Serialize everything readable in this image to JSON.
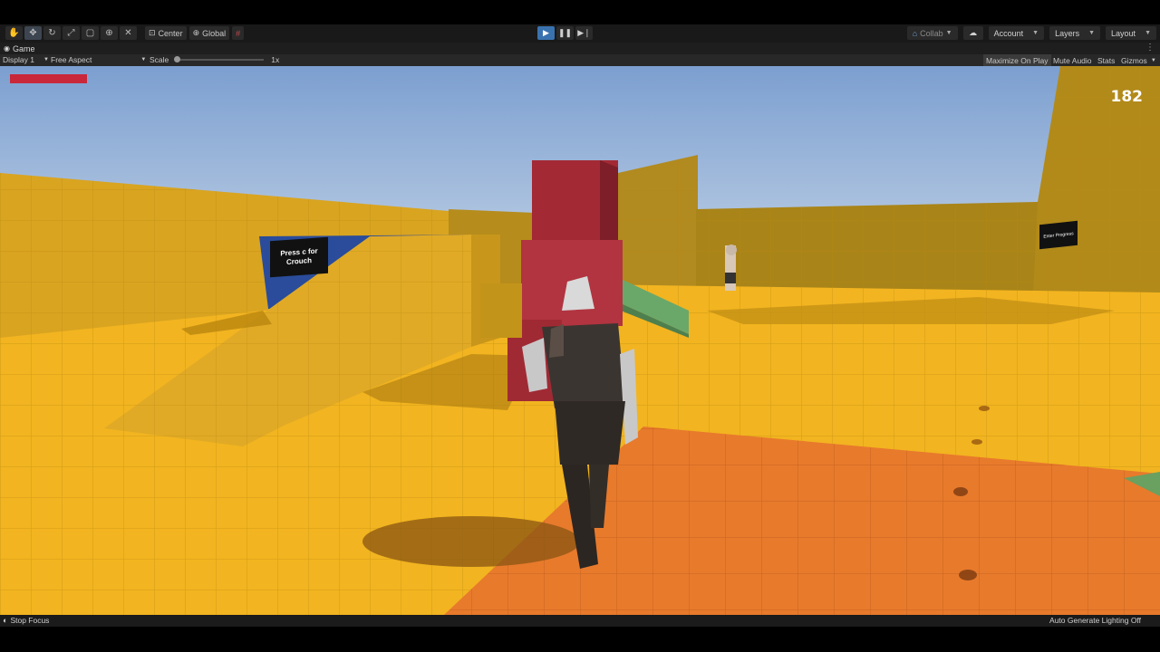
{
  "toolbar": {
    "tools": [
      {
        "icon": "hand-icon",
        "glyph": "✋"
      },
      {
        "icon": "move-icon",
        "glyph": "✥"
      },
      {
        "icon": "rotate-icon",
        "glyph": "↻"
      },
      {
        "icon": "scale-icon",
        "glyph": "⤢"
      },
      {
        "icon": "rect-icon",
        "glyph": "▢"
      },
      {
        "icon": "transform-icon",
        "glyph": "⊕"
      },
      {
        "icon": "custom-tool-icon",
        "glyph": "✕"
      }
    ],
    "pivot_label": "Center",
    "space_label": "Global",
    "play_label": "▶",
    "pause_label": "❚❚",
    "step_label": "▶❘",
    "collab_label": "Collab",
    "account_label": "Account",
    "layers_label": "Layers",
    "layout_label": "Layout"
  },
  "game_tab": {
    "label": "Game",
    "menu_glyph": "⋮"
  },
  "game_bar": {
    "display": "Display 1",
    "aspect": "Free Aspect",
    "scale_label": "Scale",
    "scale_value": "1x",
    "scale_level": 0.0,
    "maximize": "Maximize On Play",
    "mute": "Mute Audio",
    "stats": "Stats",
    "gizmos": "Gizmos"
  },
  "hud": {
    "score": "182",
    "health": 1.0
  },
  "scene": {
    "sign_crouch": "Press c for\nCrouch",
    "sign_right": "Enter Progress"
  },
  "status": {
    "left": "Stop Focus",
    "right": "Auto Generate Lighting Off"
  },
  "colors": {
    "sky_top": "#7da0d0",
    "sky_bottom": "#cfdcea",
    "floor_yellow": "#f2b420",
    "floor_orange": "#e87a2c",
    "wall_yellow": "#d9a420",
    "red_box": "#a32a35",
    "blue_wall": "#2a4c9a",
    "health": "#c8283a",
    "play_active": "#3a72b0"
  }
}
